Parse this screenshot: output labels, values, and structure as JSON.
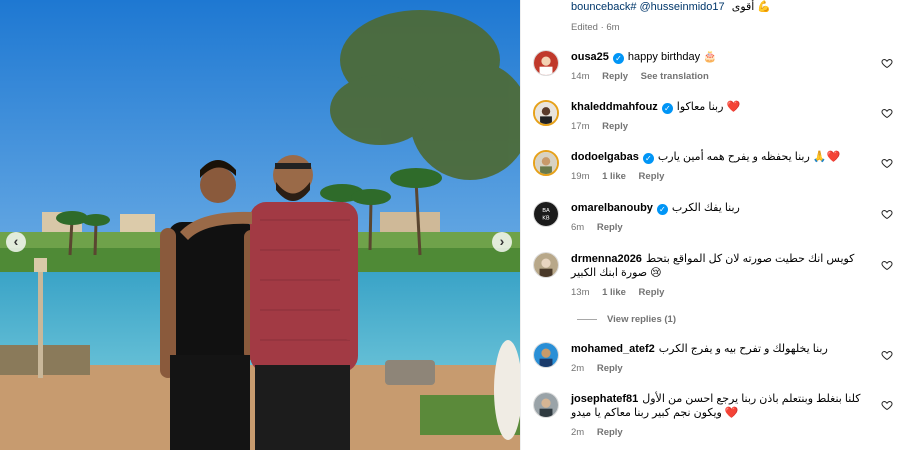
{
  "caption": {
    "handles": "bounceback# @husseinmido17",
    "arabic": "أقوى",
    "edited": "Edited · 6m"
  },
  "comments": [
    {
      "username": "ousa25",
      "verified": true,
      "text": "happy birthday 🎂",
      "time": "14m",
      "likes": "",
      "reply": "Reply",
      "extra": "See translation"
    },
    {
      "username": "khaleddmahfouz",
      "verified": true,
      "text": "ربنا معاكوا ❤️",
      "time": "17m",
      "likes": "",
      "reply": "Reply",
      "extra": ""
    },
    {
      "username": "dodoelgabas",
      "verified": true,
      "text": "ربنا يحفظه و يفرح همه أمين يارب 🙏❤️",
      "time": "19m",
      "likes": "1 like",
      "reply": "Reply",
      "extra": ""
    },
    {
      "username": "omarelbanouby",
      "verified": true,
      "text": "ربنا يفك الكرب",
      "time": "6m",
      "likes": "",
      "reply": "Reply",
      "extra": ""
    },
    {
      "username": "drmenna2026",
      "verified": false,
      "text": "كويس انك حطيت صورته لان كل المواقع بتحط صورة ابنك الكبير 😢",
      "time": "13m",
      "likes": "1 like",
      "reply": "Reply",
      "extra": ""
    },
    {
      "username": "mohamed_atef2",
      "verified": false,
      "text": "ربنا يخلهولك و تفرح بيه و يفرج الكرب",
      "time": "2m",
      "likes": "",
      "reply": "Reply",
      "extra": ""
    },
    {
      "username": "josephatef81",
      "verified": false,
      "text": "كلنا بنغلط وبنتعلم باذن ربنا يرجع احسن من الأول ويكون نجم كبير ربنا معاكم يا ميدو ❤️",
      "time": "2m",
      "likes": "",
      "reply": "Reply",
      "extra": ""
    }
  ],
  "view_replies": "View replies (1)",
  "icons": {
    "like": "heart-icon",
    "verified": "verified-badge-icon",
    "prev": "chevron-left-icon",
    "next": "chevron-right-icon"
  },
  "colors": {
    "link": "#00376b",
    "meta": "#737373",
    "verified": "#0095f6",
    "heart": "#ed4956"
  }
}
